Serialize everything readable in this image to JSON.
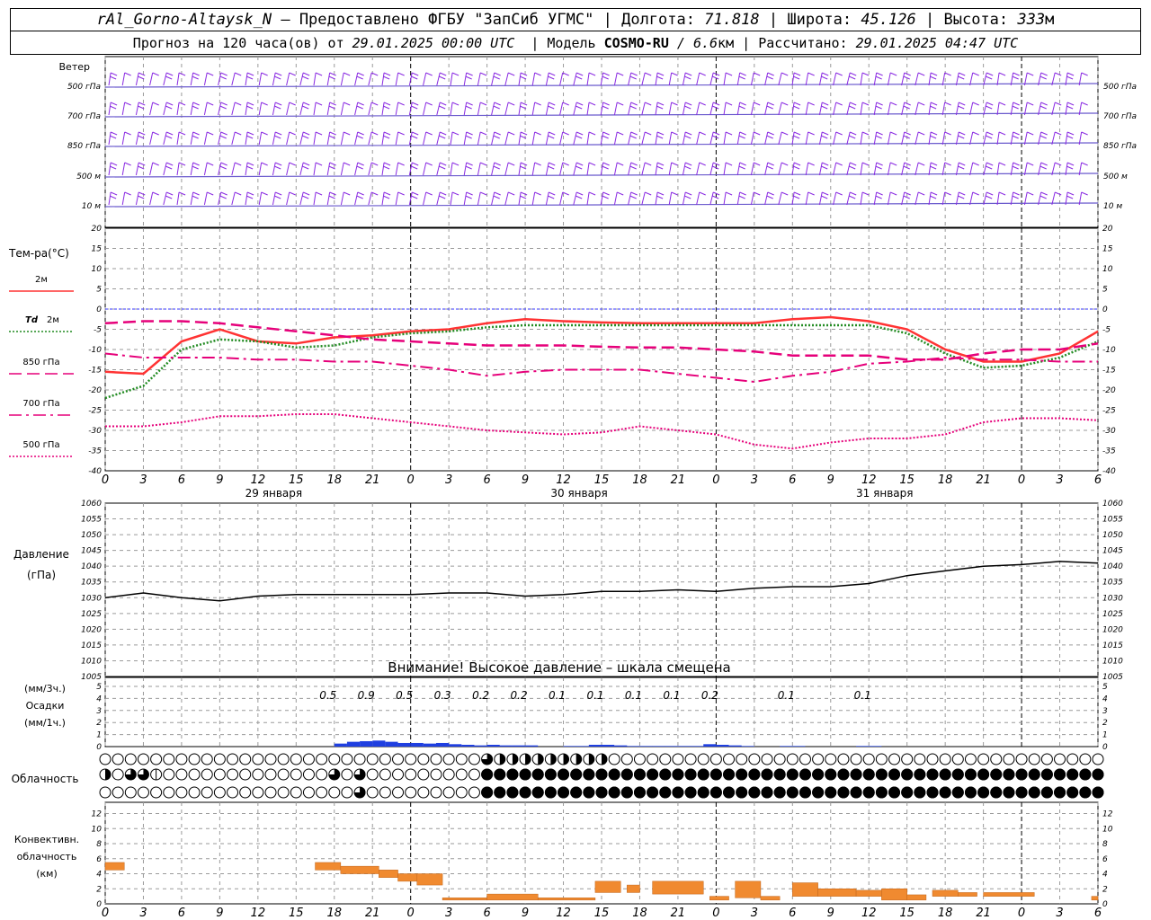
{
  "header": {
    "station": "rAl_Gorno-Altaysk_N",
    "provided": "– Предоставлено ФГБУ \"ЗапСиб УГМС\"",
    "lon_label": "Долгота:",
    "lon": "71.818",
    "lat_label": "Широта:",
    "lat": "45.126",
    "alt_label": "Высота:",
    "alt": "333",
    "alt_unit": "м",
    "forecast_prefix": "Прогноз на 120 часа(ов) от",
    "forecast_start": "29.01.2025 00:00 UTC",
    "model_label": "Модель",
    "model": "COSMO-RU",
    "model_res": "6.6",
    "model_res_unit": "км",
    "calc_label": "Рассчитано:",
    "calc_time": "29.01.2025 04:47 UTC",
    "sep": "|"
  },
  "time_axis": {
    "hour_labels": [
      "0",
      "3",
      "6",
      "9",
      "12",
      "15",
      "18",
      "21",
      "0",
      "3",
      "6",
      "9",
      "12",
      "15",
      "18",
      "21",
      "0",
      "3",
      "6",
      "9",
      "12",
      "15",
      "18",
      "21",
      "0",
      "3",
      "6"
    ],
    "day_labels": [
      "29 января",
      "30 января",
      "31 января"
    ]
  },
  "wind_panel": {
    "title": "Ветер",
    "levels": [
      "500 гПа",
      "700 гПа",
      "850 гПа",
      "500 м",
      "10 м"
    ],
    "barb_color": "#8a2be2"
  },
  "temp_panel": {
    "title": "Тем-ра(°С)",
    "legend": [
      {
        "label": "2м",
        "color": "#ff3333",
        "style": "solid"
      },
      {
        "label": "Td",
        "sub": "2м",
        "color": "#228b22",
        "style": "dotted"
      },
      {
        "label": "850 гПа",
        "color": "#e6007a",
        "style": "dash"
      },
      {
        "label": "700 гПа",
        "color": "#e6007a",
        "style": "dashdot"
      },
      {
        "label": "500 гПа",
        "color": "#e6007a",
        "style": "fine-dot"
      }
    ],
    "y_ticks": [
      "20",
      "15",
      "10",
      "5",
      "0",
      "-5",
      "-10",
      "-15",
      "-20",
      "-25",
      "-30",
      "-35",
      "-40"
    ]
  },
  "pressure_panel": {
    "title": "Давление",
    "unit": "(гПа)",
    "y_ticks": [
      "1060",
      "1055",
      "1050",
      "1045",
      "1040",
      "1035",
      "1030",
      "1025",
      "1020",
      "1015",
      "1010",
      "1005"
    ],
    "warning": "Внимание! Высокое давление – шкала смещена"
  },
  "precip_panel": {
    "title_unit_3h": "(мм/3ч.)",
    "title": "Осадки",
    "title_unit_1h": "(мм/1ч.)",
    "y_ticks": [
      "5",
      "4",
      "3",
      "2",
      "1",
      "0"
    ],
    "totals": [
      {
        "hour": 18,
        "text": "0.5"
      },
      {
        "hour": 21,
        "text": "0.9"
      },
      {
        "hour": 24,
        "text": "0.5"
      },
      {
        "hour": 27,
        "text": "0.3"
      },
      {
        "hour": 30,
        "text": "0.2"
      },
      {
        "hour": 33,
        "text": "0.2"
      },
      {
        "hour": 36,
        "text": "0.1"
      },
      {
        "hour": 39,
        "text": "0.1"
      },
      {
        "hour": 42,
        "text": "0.1"
      },
      {
        "hour": 45,
        "text": "0.1"
      },
      {
        "hour": 48,
        "text": "0.2"
      },
      {
        "hour": 54,
        "text": "0.1"
      },
      {
        "hour": 60,
        "text": "0.1"
      }
    ]
  },
  "cloud_panel": {
    "title": "Облачность"
  },
  "conv_panel": {
    "title_lines": [
      "Конвективн.",
      "облачность",
      "(км)"
    ],
    "y_ticks": [
      "12",
      "10",
      "8",
      "6",
      "4",
      "2",
      "0"
    ],
    "bar_color": "#f08a30"
  },
  "chart_data": [
    {
      "type": "line",
      "title": "Тем-ра(°С)",
      "x_unit": "hours since 29.01.2025 00:00 UTC",
      "x": [
        0,
        3,
        6,
        9,
        12,
        15,
        18,
        21,
        24,
        27,
        30,
        33,
        36,
        39,
        42,
        45,
        48,
        51,
        54,
        57,
        60,
        63,
        66,
        69,
        72,
        75,
        78
      ],
      "ylim": [
        -40,
        20
      ],
      "series": [
        {
          "name": "2м",
          "values": [
            -15.5,
            -16,
            -8,
            -5,
            -8,
            -8.5,
            -7,
            -6.5,
            -5.5,
            -5,
            -3.5,
            -2.5,
            -3,
            -3.3,
            -3.5,
            -3.5,
            -3.5,
            -3.5,
            -2.5,
            -2,
            -3,
            -5,
            -10,
            -13,
            -13,
            -11,
            -5.5
          ]
        },
        {
          "name": "Td 2м",
          "values": [
            -22,
            -19,
            -10,
            -7.5,
            -8,
            -9.5,
            -9,
            -7,
            -6,
            -5.5,
            -4.5,
            -4,
            -4,
            -4,
            -4,
            -4,
            -4,
            -4,
            -4,
            -4,
            -4,
            -6,
            -11,
            -14.5,
            -14,
            -12,
            -8
          ]
        },
        {
          "name": "850 гПа",
          "values": [
            -3.5,
            -3,
            -3,
            -3.5,
            -4.5,
            -5.5,
            -6.5,
            -7.5,
            -8,
            -8.5,
            -9,
            -9,
            -9,
            -9.3,
            -9.5,
            -9.5,
            -10,
            -10.5,
            -11.5,
            -11.5,
            -11.5,
            -12.5,
            -12.5,
            -11,
            -10,
            -10,
            -8.5
          ]
        },
        {
          "name": "700 гПа",
          "values": [
            -11,
            -12,
            -12,
            -12,
            -12.5,
            -12.5,
            -13,
            -13,
            -14,
            -15,
            -16.5,
            -15.5,
            -15,
            -15,
            -15,
            -16,
            -17,
            -18,
            -16.5,
            -15.5,
            -13.5,
            -13,
            -12,
            -12.5,
            -12.5,
            -13,
            -13
          ]
        },
        {
          "name": "500 гПа",
          "values": [
            -29,
            -29,
            -28,
            -26.5,
            -26.5,
            -26,
            -26,
            -27,
            -28,
            -29,
            -30,
            -30.5,
            -31,
            -30.5,
            -29,
            -30,
            -31,
            -33.5,
            -34.5,
            -33,
            -32,
            -32,
            -31,
            -28,
            -27,
            -27,
            -27.5
          ]
        }
      ]
    },
    {
      "type": "line",
      "title": "Давление (гПа)",
      "x_unit": "hours since 29.01.2025 00:00 UTC",
      "x": [
        0,
        3,
        6,
        9,
        12,
        15,
        18,
        21,
        24,
        27,
        30,
        33,
        36,
        39,
        42,
        45,
        48,
        51,
        54,
        57,
        60,
        63,
        66,
        69,
        72,
        75,
        78
      ],
      "ylim": [
        1005,
        1060
      ],
      "series": [
        {
          "name": "Давление",
          "values": [
            1030,
            1031.5,
            1030,
            1029,
            1030.5,
            1031,
            1031,
            1031,
            1031,
            1031.5,
            1031.5,
            1030.5,
            1031,
            1032,
            1032,
            1032.5,
            1032,
            1033,
            1033.5,
            1033.5,
            1034.5,
            1037,
            1038.5,
            1040,
            1040.5,
            1041.5,
            1041
          ]
        }
      ]
    },
    {
      "type": "bar",
      "title": "Осадки (мм/1ч.)",
      "x_unit": "hours since 29.01.2025 00:00 UTC",
      "ylim": [
        0,
        5
      ],
      "x": [
        19,
        20,
        21,
        22,
        23,
        24,
        25,
        26,
        27,
        28,
        29,
        30,
        31,
        32,
        33,
        34,
        37,
        38,
        39,
        40,
        41,
        42,
        43,
        44,
        45,
        46,
        47,
        48,
        49,
        50,
        51,
        54,
        55,
        60,
        61
      ],
      "values": [
        0.25,
        0.4,
        0.45,
        0.5,
        0.4,
        0.3,
        0.3,
        0.25,
        0.3,
        0.2,
        0.15,
        0.1,
        0.15,
        0.1,
        0.1,
        0.1,
        0.05,
        0.05,
        0.15,
        0.15,
        0.1,
        0.05,
        0.05,
        0.05,
        0.05,
        0.05,
        0.05,
        0.2,
        0.15,
        0.1,
        0.05,
        0.05,
        0.05,
        0.05,
        0.05
      ]
    },
    {
      "type": "bar",
      "title": "Конвективн. облачность (км)",
      "x_unit": "hours since 29.01.2025 00:00 UTC",
      "ylim": [
        0,
        13
      ],
      "bars": [
        {
          "x0": 0,
          "x1": 1.5,
          "bottom": 4.5,
          "top": 5.5
        },
        {
          "x0": 16.5,
          "x1": 18.5,
          "bottom": 4.5,
          "top": 5.5
        },
        {
          "x0": 18.5,
          "x1": 21.5,
          "bottom": 4,
          "top": 5
        },
        {
          "x0": 21.5,
          "x1": 23,
          "bottom": 3.5,
          "top": 4.5
        },
        {
          "x0": 23,
          "x1": 24.5,
          "bottom": 3,
          "top": 4
        },
        {
          "x0": 24.5,
          "x1": 26.5,
          "bottom": 2.5,
          "top": 4
        },
        {
          "x0": 26.5,
          "x1": 30,
          "bottom": 0.5,
          "top": 0.8
        },
        {
          "x0": 30,
          "x1": 34,
          "bottom": 0.5,
          "top": 1.3
        },
        {
          "x0": 34,
          "x1": 38.5,
          "bottom": 0.5,
          "top": 0.8
        },
        {
          "x0": 38.5,
          "x1": 40.5,
          "bottom": 1.5,
          "top": 3
        },
        {
          "x0": 41,
          "x1": 42,
          "bottom": 1.5,
          "top": 2.5
        },
        {
          "x0": 43,
          "x1": 47,
          "bottom": 1.3,
          "top": 3
        },
        {
          "x0": 47.5,
          "x1": 49,
          "bottom": 0.5,
          "top": 1
        },
        {
          "x0": 49.5,
          "x1": 51.5,
          "bottom": 0.8,
          "top": 3
        },
        {
          "x0": 51.5,
          "x1": 53,
          "bottom": 0.5,
          "top": 1
        },
        {
          "x0": 54,
          "x1": 56,
          "bottom": 1,
          "top": 2.8
        },
        {
          "x0": 56,
          "x1": 59,
          "bottom": 1,
          "top": 2
        },
        {
          "x0": 59,
          "x1": 61,
          "bottom": 1,
          "top": 1.8
        },
        {
          "x0": 61,
          "x1": 63,
          "bottom": 0.5,
          "top": 2
        },
        {
          "x0": 63,
          "x1": 64.5,
          "bottom": 0.5,
          "top": 1.2
        },
        {
          "x0": 65,
          "x1": 67,
          "bottom": 1,
          "top": 1.8
        },
        {
          "x0": 67,
          "x1": 68.5,
          "bottom": 1,
          "top": 1.5
        },
        {
          "x0": 69,
          "x1": 73,
          "bottom": 1,
          "top": 1.5
        },
        {
          "x0": 77.5,
          "x1": 78,
          "bottom": 0.5,
          "top": 1
        }
      ]
    },
    {
      "type": "table",
      "title": "Облачность",
      "note": "Rows: upper, middle, lower cloud cover per 3-hour step (0–4 eighths filled)",
      "rows": [
        [
          0,
          0,
          0,
          0,
          0,
          0,
          0,
          0,
          0,
          0,
          0,
          0,
          0,
          0,
          0,
          0,
          0,
          0,
          0,
          0,
          0,
          0,
          0,
          0,
          0,
          0,
          0,
          0,
          0,
          0,
          3,
          2,
          2,
          2,
          2,
          2,
          2,
          2,
          2,
          2,
          0,
          0,
          0,
          0,
          0,
          0,
          0,
          0,
          0,
          0,
          0,
          0,
          0,
          0,
          0,
          0,
          0,
          0,
          0,
          0,
          0,
          0,
          0,
          0,
          0,
          0,
          0,
          0,
          0,
          0,
          0,
          0,
          0,
          0,
          0,
          0,
          0,
          0,
          0,
          0,
          0
        ],
        [
          2,
          0,
          3,
          3,
          1,
          0,
          0,
          0,
          0,
          0,
          0,
          0,
          0,
          0,
          0,
          0,
          0,
          0,
          3,
          0,
          3,
          0,
          0,
          0,
          0,
          0,
          0,
          0,
          0,
          0,
          4,
          4,
          4,
          4,
          4,
          4,
          4,
          4,
          4,
          4,
          4,
          4,
          4,
          4,
          4,
          4,
          4,
          4,
          4,
          4,
          4,
          4,
          4,
          4,
          4,
          4,
          4,
          4,
          4,
          4,
          4,
          4,
          4,
          4,
          4,
          4,
          4,
          4,
          4,
          4,
          4,
          4,
          4,
          4,
          4,
          4,
          4,
          4,
          4,
          4,
          4,
          4,
          4,
          4,
          4,
          4,
          4,
          4,
          4,
          4,
          4
        ],
        [
          0,
          0,
          0,
          0,
          0,
          0,
          0,
          0,
          0,
          0,
          0,
          0,
          0,
          0,
          0,
          0,
          0,
          0,
          0,
          0,
          3,
          0,
          0,
          0,
          0,
          0,
          0,
          0,
          0,
          0,
          4,
          4,
          4,
          4,
          4,
          4,
          4,
          4,
          4,
          4,
          4,
          4,
          4,
          4,
          4,
          4,
          4,
          4,
          4,
          4,
          4,
          4,
          4,
          4,
          4,
          4,
          4,
          4,
          4,
          4,
          4,
          4,
          4,
          4,
          4,
          4,
          4,
          4,
          4,
          4,
          4,
          4,
          4,
          4,
          4,
          4,
          4,
          4,
          4,
          4,
          4,
          4,
          4,
          4,
          4,
          4,
          4,
          4,
          4,
          4,
          4
        ]
      ]
    }
  ]
}
